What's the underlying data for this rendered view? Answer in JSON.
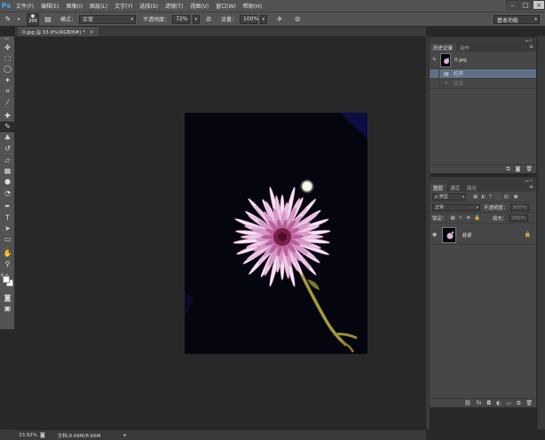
{
  "app": {
    "logo": "Ps"
  },
  "menu": [
    "文件(F)",
    "编辑(E)",
    "图像(I)",
    "图层(L)",
    "文字(Y)",
    "选择(S)",
    "滤镜(T)",
    "视图(V)",
    "窗口(W)",
    "帮助(H)"
  ],
  "options": {
    "brush_size": "200",
    "mode_label": "模式：",
    "mode_value": "正常",
    "opacity_label": "不透明度：",
    "opacity_value": "72%",
    "flow_label": "流量：",
    "flow_value": "100%",
    "workspace": "基本功能"
  },
  "document": {
    "tab_title": "0.jpg @ 33.9%(RGB/8#) *",
    "tab_close": "×"
  },
  "history_panel": {
    "tabs": [
      "历史记录",
      "动作"
    ],
    "snapshot_name": "0.jpg",
    "items": [
      {
        "label": "打开",
        "state": "selected"
      },
      {
        "label": "画笔",
        "state": "dim"
      }
    ]
  },
  "layers_panel": {
    "tabs": [
      "图层",
      "通道",
      "路径"
    ],
    "filter_type": "ρ 类型",
    "blend_mode": "正常",
    "opacity_label": "不透明度：",
    "opacity_value": "100%",
    "lock_label": "锁定：",
    "fill_label": "填充：",
    "fill_value": "100%",
    "layer_name": "背景"
  },
  "status": {
    "zoom": "33.92%",
    "doc_info": "文档:8.66M/8.66M"
  },
  "colors": {
    "foreground": "#ffffff",
    "background": "#ffffff",
    "selection": "#5f6f85",
    "image_bg": "#05050f"
  }
}
